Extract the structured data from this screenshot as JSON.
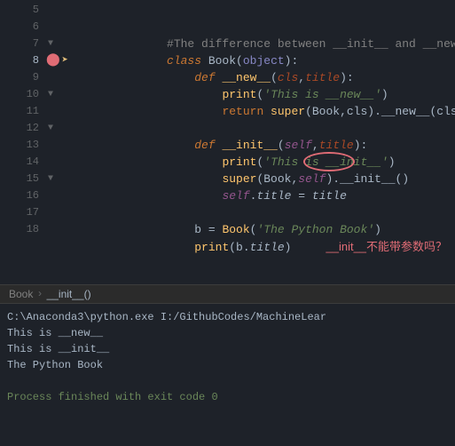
{
  "editor": {
    "lines": [
      {
        "num": "5",
        "content": "",
        "indent": 0
      },
      {
        "num": "6",
        "content": "",
        "indent": 0
      },
      {
        "num": "7",
        "content": "class Book(object):",
        "indent": 0,
        "foldable": true
      },
      {
        "num": "8",
        "content": "    def __new__(cls, title):",
        "indent": 1,
        "breakpoint": true,
        "arrow": true
      },
      {
        "num": "9",
        "content": "        print('This is __new__')",
        "indent": 2
      },
      {
        "num": "10",
        "content": "        return super(Book,cls).__new__(cls)",
        "indent": 2,
        "foldable": true
      },
      {
        "num": "11",
        "content": "",
        "indent": 0
      },
      {
        "num": "12",
        "content": "    def __init__(self, title):",
        "indent": 1,
        "foldable": true
      },
      {
        "num": "13",
        "content": "        print('This is __init__')",
        "indent": 2
      },
      {
        "num": "14",
        "content": "        super(Book,self).__init__()",
        "indent": 2,
        "oval": true
      },
      {
        "num": "15",
        "content": "        self.title = title",
        "indent": 2,
        "foldable": true
      },
      {
        "num": "16",
        "content": "",
        "indent": 0
      },
      {
        "num": "17",
        "content": "    b = Book('The Python Book')",
        "indent": 1
      },
      {
        "num": "18",
        "content": "    print(b.title)     __init__不能带参数吗？",
        "indent": 1
      }
    ],
    "annotation": "__init__不能带参数吗？",
    "oval_line": 14
  },
  "breadcrumb": {
    "file": "Book",
    "separator": "›",
    "method": "__init__()"
  },
  "terminal": {
    "path": "C:\\Anaconda3\\python.exe I:/GithubCodes/MachineLear",
    "lines": [
      "This is __new__",
      "This is __init__",
      "The Python Book",
      "",
      "Process finished with exit code 0"
    ]
  },
  "colors": {
    "bg": "#1e2229",
    "gutter_bg": "#1e2229",
    "terminal_bg": "#1e2229",
    "breadcrumb_bg": "#2b2b2b",
    "keyword": "#cc7832",
    "string": "#6a8759",
    "comment": "#808080",
    "annotation": "#e06c75"
  }
}
